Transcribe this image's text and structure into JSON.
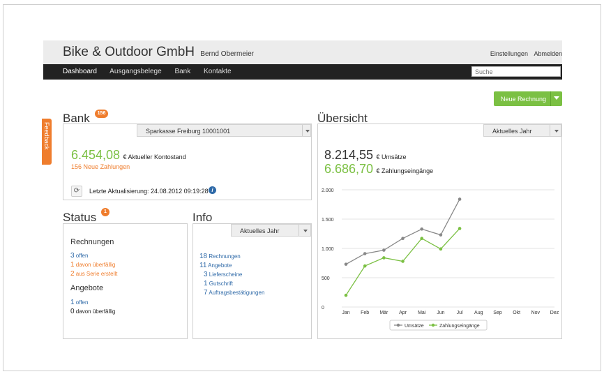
{
  "header": {
    "company": "Bike & Outdoor GmbH",
    "user": "Bernd Obermeier",
    "settings_label": "Einstellungen",
    "logout_label": "Abmelden"
  },
  "nav": {
    "items": [
      {
        "label": "Dashboard",
        "active": true
      },
      {
        "label": "Ausgangsbelege",
        "active": false
      },
      {
        "label": "Bank",
        "active": false
      },
      {
        "label": "Kontakte",
        "active": false
      }
    ],
    "search_placeholder": "Suche"
  },
  "new_invoice_label": "Neue Rechnung",
  "feedback_label": "Feedback",
  "bank": {
    "title": "Bank",
    "badge": "156",
    "account_select": "Sparkasse Freiburg 10001001",
    "balance_value": "6.454,08",
    "balance_label": "€ Aktueller Kontostand",
    "new_payments_count": "156",
    "new_payments_label": "Neue Zahlungen",
    "last_update": "Letzte Aktualisierung: 24.08.2012 09:19:28"
  },
  "status": {
    "title": "Status",
    "badge": "1",
    "invoices_heading": "Rechnungen",
    "invoices": [
      {
        "count": "3",
        "label": "offen",
        "color": "#2f6aa8"
      },
      {
        "count": "1",
        "label": "davon überfällig",
        "color": "#ef7d2d"
      },
      {
        "count": "2",
        "label": "aus Serie erstellt",
        "color": "#ef7d2d"
      }
    ],
    "offers_heading": "Angebote",
    "offers": [
      {
        "count": "1",
        "label": "offen",
        "color": "#2f6aa8"
      },
      {
        "count": "0",
        "label": "davon überfällig",
        "color": "#222222"
      }
    ]
  },
  "info": {
    "title": "Info",
    "period_select": "Aktuelles Jahr",
    "items": [
      {
        "count": "18",
        "label": "Rechnungen"
      },
      {
        "count": "11",
        "label": "Angebote"
      },
      {
        "count": "3",
        "label": "Lieferscheine"
      },
      {
        "count": "1",
        "label": "Gutschrift"
      },
      {
        "count": "7",
        "label": "Auftragsbestätigungen"
      }
    ]
  },
  "overview": {
    "title": "Übersicht",
    "period_select": "Aktuelles Jahr",
    "revenue_value": "8.214,55",
    "revenue_label": "€ Umsätze",
    "receipts_value": "6.686,70",
    "receipts_label": "€ Zahlungseingänge"
  },
  "colors": {
    "accent_green": "#7bc043",
    "accent_orange": "#ef7d2d",
    "link_blue": "#2f6aa8",
    "series_gray": "#888888"
  },
  "chart_data": {
    "type": "line",
    "categories": [
      "Jan",
      "Feb",
      "Mär",
      "Apr",
      "Mai",
      "Jun",
      "Jul",
      "Aug",
      "Sep",
      "Okt",
      "Nov",
      "Dez"
    ],
    "ylim": [
      0,
      2000
    ],
    "yticks": [
      "0",
      "500",
      "1.000",
      "1.500",
      "2.000"
    ],
    "ytick_values": [
      0,
      500,
      1000,
      1500,
      2000
    ],
    "grid": true,
    "legend_position": "bottom",
    "series": [
      {
        "name": "Umsätze",
        "color": "#888888",
        "values": [
          730,
          910,
          970,
          1170,
          1330,
          1230,
          1840
        ]
      },
      {
        "name": "Zahlungseingänge",
        "color": "#7bc043",
        "values": [
          200,
          700,
          840,
          780,
          1170,
          990,
          1340
        ]
      }
    ]
  }
}
